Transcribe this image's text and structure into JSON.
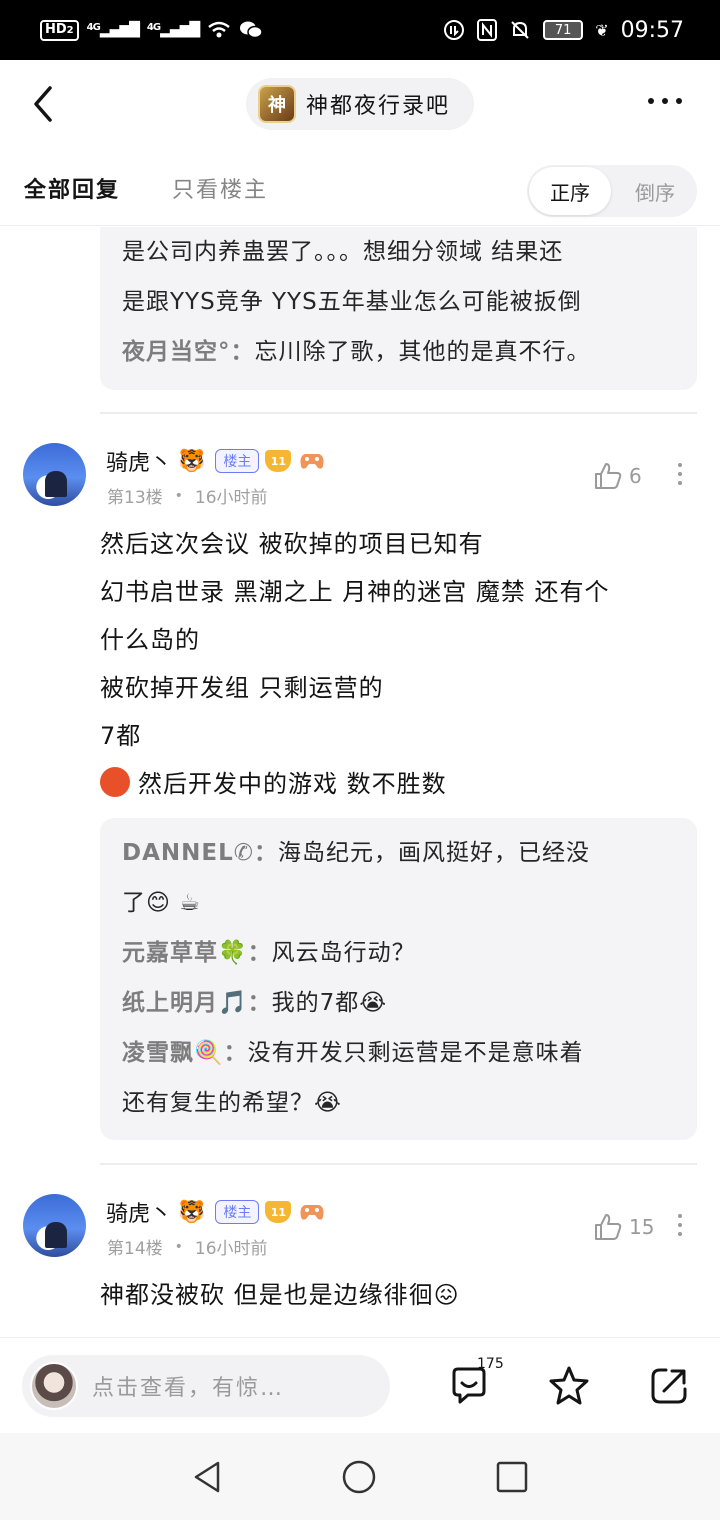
{
  "status_bar": {
    "hd_label": "HD",
    "hd_sub": "2",
    "sim1": "4G",
    "sim2": "4G",
    "battery": "71",
    "time": "09:57"
  },
  "header": {
    "forum_logo_text": "神",
    "forum_name": "神都夜行录吧"
  },
  "tabs": {
    "all_replies": "全部回复",
    "owner_only": "只看楼主",
    "order_asc": "正序",
    "order_desc": "倒序"
  },
  "prev_quote": {
    "lines": [
      "是公司内养蛊罢了。。。想细分领域 结果还",
      "是跟YYS竞争 YYS五年基业怎么可能被扳倒"
    ],
    "reply": {
      "name": "夜月当空°：",
      "text": "忘川除了歌，其他的是真不行。"
    }
  },
  "posts": [
    {
      "username": "骑虎丶",
      "user_emoji": "🐯",
      "owner_badge": "楼主",
      "level": "11",
      "floor": "第13楼",
      "time": "16小时前",
      "likes": "6",
      "lines": [
        "然后这次会议 被砍掉的项目已知有",
        "幻书启世录 黑潮之上 月神的迷宫 魔禁 还有个",
        "什么岛的",
        "被砍掉开发组 只剩运营的",
        "7都",
        "然后开发中的游戏 数不胜数"
      ],
      "replies": [
        {
          "name": "DANNEL✆：",
          "text": "海岛纪元，画风挺好，已经没",
          "cont": "了😊 ☕"
        },
        {
          "name": "元嘉草草🍀：",
          "text": "风云岛行动？"
        },
        {
          "name": "纸上明月🎵：",
          "text": "我的7都😭"
        },
        {
          "name": "凌雪飘🍭：",
          "text": "没有开发只剩运营是不是意味着",
          "cont": "还有复生的希望？😭"
        }
      ]
    },
    {
      "username": "骑虎丶",
      "user_emoji": "🐯",
      "owner_badge": "楼主",
      "level": "11",
      "floor": "第14楼",
      "time": "16小时前",
      "likes": "15",
      "lines": [
        "神都没被砍 但是也是边缘徘徊😖"
      ]
    }
  ],
  "bottom_bar": {
    "placeholder": "点击查看，有惊…",
    "comment_count": "175"
  }
}
